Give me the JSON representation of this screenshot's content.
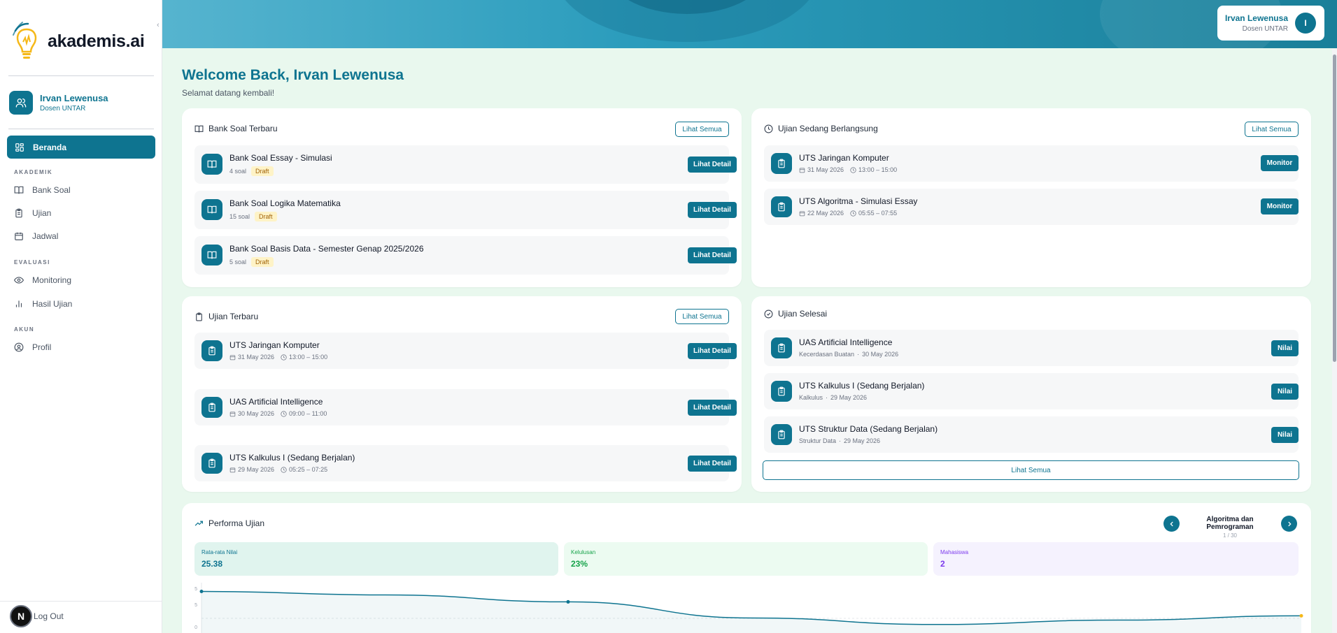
{
  "app": {
    "name": "akademis.ai"
  },
  "sidebar": {
    "user": {
      "name": "Irvan Lewenusa",
      "role": "Dosen UNTAR"
    },
    "active": {
      "label": "Beranda"
    },
    "sections": {
      "akademik": "AKADEMIK",
      "evaluasi": "EVALUASI",
      "akun": "AKUN"
    },
    "items": {
      "bank_soal": "Bank Soal",
      "ujian": "Ujian",
      "jadwal": "Jadwal",
      "monitoring": "Monitoring",
      "hasil_ujian": "Hasil Ujian",
      "profil": "Profil"
    },
    "logout": "Log Out",
    "badge": "N"
  },
  "header": {
    "user_name": "Irvan Lewenusa",
    "user_role": "Dosen UNTAR",
    "avatar": "I"
  },
  "welcome": {
    "title": "Welcome Back, Irvan Lewenusa",
    "subtitle": "Selamat datang kembali!"
  },
  "bank_soal_card": {
    "title": "Bank Soal Terbaru",
    "see_all": "Lihat Semua",
    "items": [
      {
        "title": "Bank Soal Essay - Simulasi",
        "count": "4 soal",
        "status": "Draft",
        "action": "Lihat Detail"
      },
      {
        "title": "Bank Soal Logika Matematika",
        "count": "15 soal",
        "status": "Draft",
        "action": "Lihat Detail"
      },
      {
        "title": "Bank Soal Basis Data - Semester Genap 2025/2026",
        "count": "5 soal",
        "status": "Draft",
        "action": "Lihat Detail"
      }
    ]
  },
  "ongoing_card": {
    "title": "Ujian Sedang Berlangsung",
    "see_all": "Lihat Semua",
    "items": [
      {
        "title": "UTS Jaringan Komputer",
        "date": "31 May 2026",
        "time": "13:00 – 15:00",
        "action": "Monitor"
      },
      {
        "title": "UTS Algoritma - Simulasi Essay",
        "date": "22 May 2026",
        "time": "05:55 – 07:55",
        "action": "Monitor"
      }
    ]
  },
  "recent_card": {
    "title": "Ujian Terbaru",
    "see_all": "Lihat Semua",
    "items": [
      {
        "title": "UTS Jaringan Komputer",
        "date": "31 May 2026",
        "time": "13:00 – 15:00",
        "action": "Lihat Detail"
      },
      {
        "title": "UAS Artificial Intelligence",
        "date": "30 May 2026",
        "time": "09:00 – 11:00",
        "action": "Lihat Detail"
      },
      {
        "title": "UTS Kalkulus I (Sedang Berjalan)",
        "date": "29 May 2026",
        "time": "05:25 – 07:25",
        "action": "Lihat Detail"
      }
    ]
  },
  "done_card": {
    "title": "Ujian Selesai",
    "see_all": "Lihat Semua",
    "items": [
      {
        "title": "UAS Artificial Intelligence",
        "subject": "Kecerdasan Buatan",
        "date": "30 May 2026",
        "action": "Nilai"
      },
      {
        "title": "UTS Kalkulus I (Sedang Berjalan)",
        "subject": "Kalkulus",
        "date": "29 May 2026",
        "action": "Nilai"
      },
      {
        "title": "UTS Struktur Data (Sedang Berjalan)",
        "subject": "Struktur Data",
        "date": "29 May 2026",
        "action": "Nilai"
      }
    ]
  },
  "performance": {
    "title": "Performa Ujian",
    "course": "Algoritma dan Pemrograman",
    "pager": "1 / 30",
    "stats": {
      "avg_label": "Rata-rata Nilai",
      "avg_value": "25.38",
      "pass_label": "Kelulusan",
      "pass_value": "23%",
      "students_label": "Mahasiswa",
      "students_value": "2"
    },
    "ticks": [
      "5",
      "5",
      "0"
    ],
    "colors": {
      "accent": "#0e7490",
      "pass": "#16a34a",
      "students": "#7c3aed"
    }
  },
  "chart_data": {
    "type": "line",
    "title": "",
    "xlabel": "",
    "ylabel": "",
    "y_ticks": [
      "5",
      "5",
      "0"
    ],
    "series": [
      {
        "values": [
          5.6,
          4.8,
          3.2,
          -0.5,
          -2,
          -1,
          0
        ]
      }
    ]
  }
}
